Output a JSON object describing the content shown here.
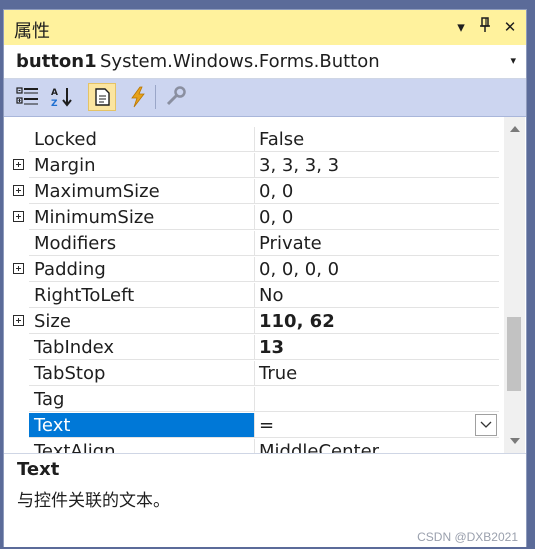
{
  "panel": {
    "title": "属性",
    "buttons": {
      "dropdown": "▾",
      "pin": "⊥",
      "close": "✕"
    }
  },
  "object_selector": {
    "name": "button1",
    "type": "System.Windows.Forms.Button",
    "dropdown_glyph": "▾"
  },
  "toolbar": {
    "tools": [
      {
        "name": "categorized-icon",
        "active": false
      },
      {
        "name": "alphabetical-icon",
        "active": false
      },
      {
        "name": "properties-icon",
        "active": true
      },
      {
        "name": "events-icon",
        "active": false
      },
      {
        "name": "property-pages-icon",
        "active": false
      }
    ]
  },
  "properties": [
    {
      "name": "Locked",
      "value": "False",
      "expandable": false,
      "bold": false
    },
    {
      "name": "Margin",
      "value": "3, 3, 3, 3",
      "expandable": true,
      "bold": false
    },
    {
      "name": "MaximumSize",
      "value": "0, 0",
      "expandable": true,
      "bold": false
    },
    {
      "name": "MinimumSize",
      "value": "0, 0",
      "expandable": true,
      "bold": false
    },
    {
      "name": "Modifiers",
      "value": "Private",
      "expandable": false,
      "bold": false
    },
    {
      "name": "Padding",
      "value": "0, 0, 0, 0",
      "expandable": true,
      "bold": false
    },
    {
      "name": "RightToLeft",
      "value": "No",
      "expandable": false,
      "bold": false
    },
    {
      "name": "Size",
      "value": "110, 62",
      "expandable": true,
      "bold": true
    },
    {
      "name": "TabIndex",
      "value": "13",
      "expandable": false,
      "bold": true
    },
    {
      "name": "TabStop",
      "value": "True",
      "expandable": false,
      "bold": false
    },
    {
      "name": "Tag",
      "value": "",
      "expandable": false,
      "bold": false
    },
    {
      "name": "Text",
      "value": "=",
      "expandable": false,
      "bold": false,
      "selected": true
    },
    {
      "name": "TextAlign",
      "value": "MiddleCenter",
      "expandable": false,
      "bold": false
    }
  ],
  "description": {
    "title": "Text",
    "text": "与控件关联的文本。"
  },
  "watermark": "CSDN @DXB2021",
  "colors": {
    "title_bar": "#fff29d",
    "toolbar": "#ccd5f0",
    "selection": "#0078d7",
    "frame": "#5b6b99"
  }
}
